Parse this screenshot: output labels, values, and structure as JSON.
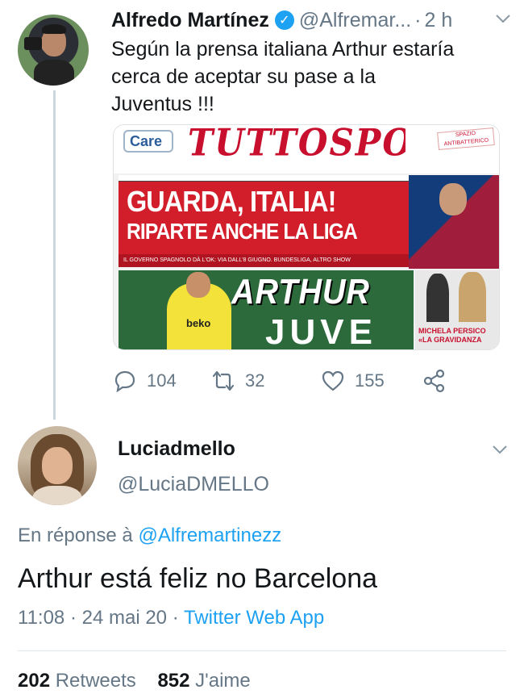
{
  "parent_tweet": {
    "author_name": "Alfredo Martínez",
    "verified_icon": "check-badge-icon",
    "handle": "@Alfremar...",
    "separator": "·",
    "time": "2 h",
    "text_lines": [
      "Según la prensa italiana Arthur estaría",
      "cerca de aceptar su pase a la",
      "Juventus !!!"
    ],
    "media": {
      "care_label": "Care",
      "masthead": "TUTTOSPORT",
      "badge_text": "SPAZIO ANTIBATTERICO",
      "headline_1": "GUARDA, ITALIA!",
      "headline_2": "RIPARTE ANCHE LA LIGA",
      "strip_text": "IL GOVERNO SPAGNOLO DÀ L'OK: VIA DALL'8 GIUGNO. BUNDESLIGA, ALTRO SHOW",
      "sponsor": "beko",
      "headline_3": "ARTHUR",
      "headline_4": "JUVE",
      "side_caption_1": "MICHELA PERSICO",
      "side_caption_2": "«LA GRAVIDANZA"
    },
    "actions": {
      "reply_count": "104",
      "retweet_count": "32",
      "like_count": "155"
    }
  },
  "reply_tweet": {
    "author_name": "Luciadmello",
    "handle": "@LuciaDMELLO",
    "in_reply_prefix": "En réponse à",
    "in_reply_handle": "@Alfremartinezz",
    "text": "Arthur está feliz no Barcelona",
    "time": "11:08",
    "dot": "·",
    "date": "24 mai 20",
    "dot2": "·",
    "source": "Twitter Web App",
    "retweets_count": "202",
    "retweets_label": "Retweets",
    "likes_count": "852",
    "likes_label": "J'aime"
  },
  "colors": {
    "accent": "#1da1f2",
    "muted": "#657786",
    "text": "#14171a"
  }
}
